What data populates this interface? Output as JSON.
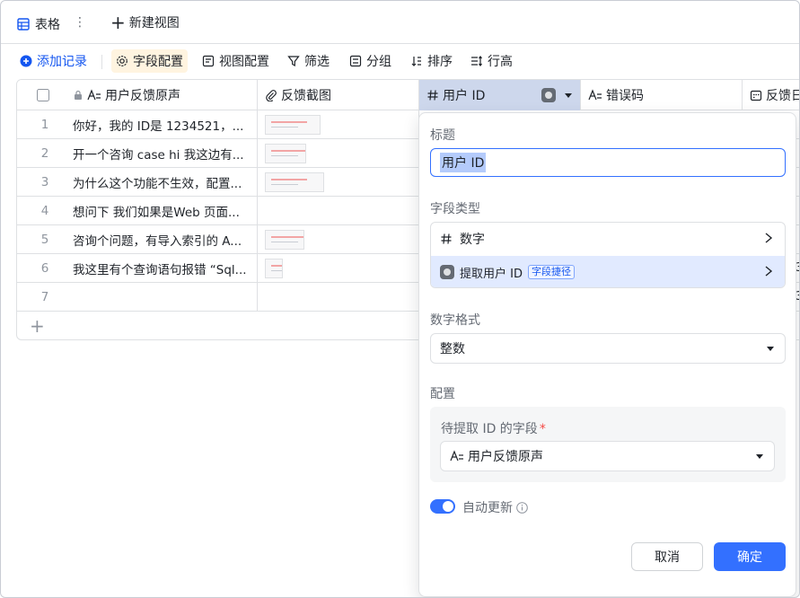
{
  "tabs": {
    "active_label": "表格",
    "new_view_label": "新建视图"
  },
  "toolbar": {
    "add_record": "添加记录",
    "field_config": "字段配置",
    "view_config": "视图配置",
    "filter": "筛选",
    "group": "分组",
    "sort": "排序",
    "row_height": "行高"
  },
  "table": {
    "columns": [
      "用户反馈原声",
      "反馈截图",
      "用户 ID",
      "错误码",
      "反馈日"
    ],
    "rows": [
      {
        "num": "1",
        "text": "你好，我的 ID是 1234521，...",
        "has_image": true
      },
      {
        "num": "2",
        "text": "开一个咨询 case hi 我这边有...",
        "has_image": true
      },
      {
        "num": "3",
        "text": "为什么这个功能不生效，配置...",
        "has_image": true
      },
      {
        "num": "4",
        "text": "想问下 我们如果是Web 页面...",
        "has_image": false
      },
      {
        "num": "5",
        "text": "咨询个问题，有导入索引的 A...",
        "has_image": true
      },
      {
        "num": "6",
        "text": "我这里有个查询语句报错 “Sql...",
        "has_image": true
      },
      {
        "num": "7",
        "text": "",
        "has_image": false
      }
    ]
  },
  "panel": {
    "title_label": "标题",
    "title_value": "用户 ID",
    "field_type_label": "字段类型",
    "type_number": "数字",
    "type_extract": "提取用户 ID",
    "type_extract_tag": "字段捷径",
    "number_format_label": "数字格式",
    "number_format_value": "整数",
    "config_label": "配置",
    "source_field_label": "待提取 ID 的字段",
    "source_field_required": "*",
    "source_field_value": "用户反馈原声",
    "auto_update_label": "自动更新",
    "auto_update_on": true,
    "cancel": "取消",
    "confirm": "确定"
  },
  "colors": {
    "primary": "#3370ff",
    "link": "#1456f0",
    "selected_header": "#cdd7ec",
    "toolbar_active": "#fff4e0"
  }
}
